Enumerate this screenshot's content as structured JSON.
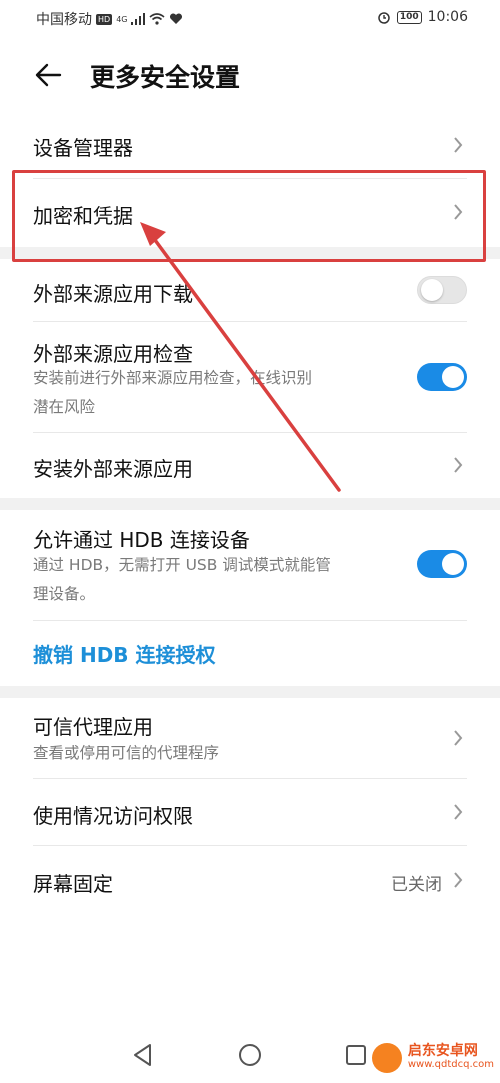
{
  "status_bar": {
    "carrier": "中国移动",
    "hd_badge": "HD",
    "network": "4G",
    "battery": "100",
    "time": "10:06"
  },
  "header": {
    "title": "更多安全设置"
  },
  "items": {
    "device_manager": "设备管理器",
    "encryption": "加密和凭据",
    "external_download": "外部来源应用下载",
    "external_check": "外部来源应用检查",
    "external_check_desc_line1": "安装前进行外部来源应用检查，在线识别",
    "external_check_desc_line2": "潜在风险",
    "install_external": "安装外部来源应用",
    "hdb_allow": "允许通过 HDB 连接设备",
    "hdb_desc_line1": "通过 HDB，无需打开 USB 调试模式就能管",
    "hdb_desc_line2": "理设备。",
    "hdb_revoke": "撤销 HDB 连接授权",
    "trust_agents": "可信代理应用",
    "trust_agents_desc": "查看或停用可信的代理程序",
    "usage_access": "使用情况访问权限",
    "screen_pinning": "屏幕固定",
    "screen_pinning_value": "已关闭"
  },
  "toggles": {
    "external_download": "off",
    "external_check": "on",
    "hdb_allow": "on"
  },
  "colors": {
    "accent": "#1a8be6",
    "link": "#1d8fd8",
    "annotation": "#d9403f"
  },
  "watermark": {
    "name": "启东安卓网",
    "url": "www.qdtdcq.com"
  }
}
